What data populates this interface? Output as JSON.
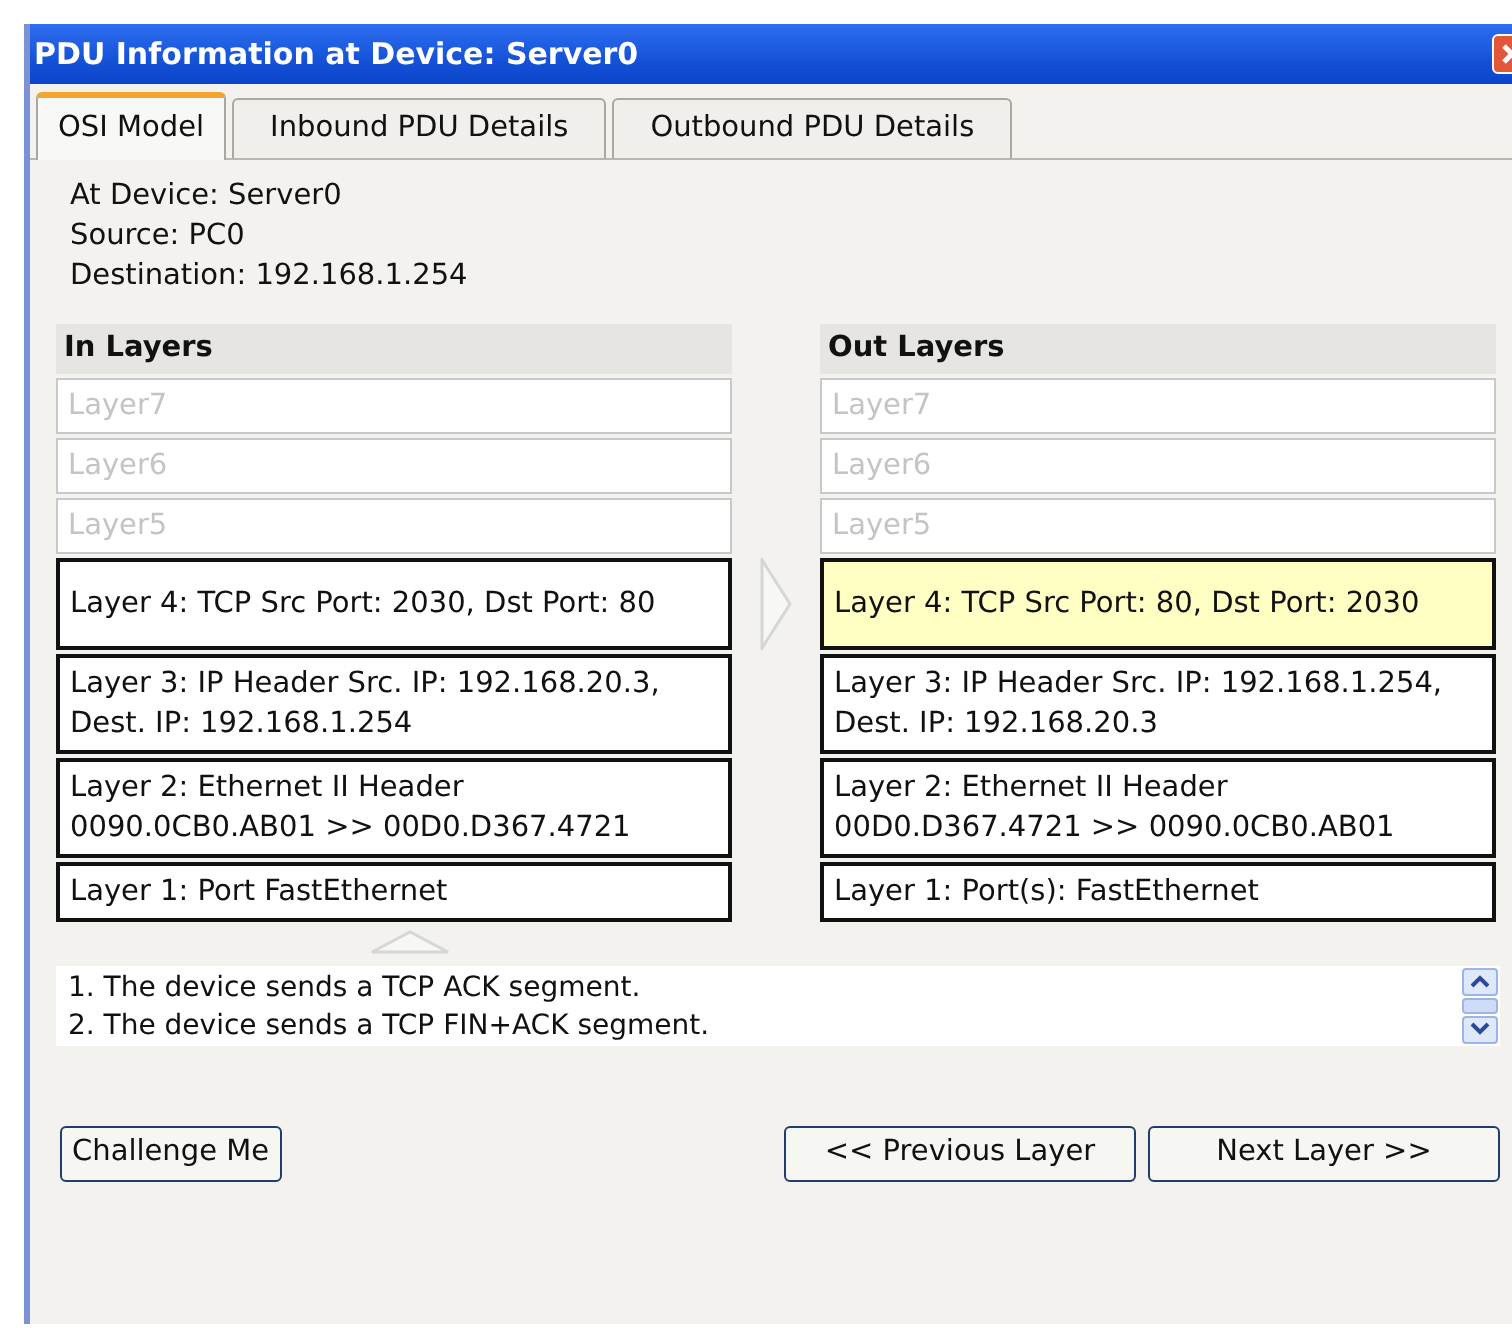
{
  "window": {
    "title": "PDU Information at Device: Server0"
  },
  "tabs": [
    {
      "label": "OSI Model",
      "selected": true
    },
    {
      "label": "Inbound PDU Details",
      "selected": false
    },
    {
      "label": "Outbound PDU Details",
      "selected": false
    }
  ],
  "info": [
    "At Device: Server0",
    "Source: PC0",
    "Destination: 192.168.1.254"
  ],
  "in_layers": {
    "heading": "In Layers",
    "layers": [
      {
        "text": "Layer7",
        "disabled": true,
        "selected": false
      },
      {
        "text": "Layer6",
        "disabled": true,
        "selected": false
      },
      {
        "text": "Layer5",
        "disabled": true,
        "selected": false
      },
      {
        "text": "Layer 4: TCP Src Port: 2030, Dst Port: 80",
        "disabled": false,
        "selected": false
      },
      {
        "text": "Layer 3: IP Header Src. IP: 192.168.20.3, Dest. IP: 192.168.1.254",
        "disabled": false,
        "selected": false
      },
      {
        "text": "Layer 2: Ethernet II Header 0090.0CB0.AB01 >> 00D0.D367.4721",
        "disabled": false,
        "selected": false
      },
      {
        "text": "Layer 1: Port FastEthernet",
        "disabled": false,
        "selected": false
      }
    ]
  },
  "out_layers": {
    "heading": "Out Layers",
    "layers": [
      {
        "text": "Layer7",
        "disabled": true,
        "selected": false
      },
      {
        "text": "Layer6",
        "disabled": true,
        "selected": false
      },
      {
        "text": "Layer5",
        "disabled": true,
        "selected": false
      },
      {
        "text": "Layer 4: TCP Src Port: 80, Dst Port: 2030",
        "disabled": false,
        "selected": true
      },
      {
        "text": "Layer 3: IP Header Src. IP: 192.168.1.254, Dest. IP: 192.168.20.3",
        "disabled": false,
        "selected": false
      },
      {
        "text": "Layer 2: Ethernet II Header 00D0.D367.4721 >> 0090.0CB0.AB01",
        "disabled": false,
        "selected": false
      },
      {
        "text": "Layer 1: Port(s): FastEthernet",
        "disabled": false,
        "selected": false
      }
    ]
  },
  "steps": [
    "1. The device sends a TCP ACK segment.",
    "2. The device sends a TCP FIN+ACK segment."
  ],
  "buttons_left": [
    "Challenge Me"
  ],
  "buttons_right": [
    "<< Previous Layer",
    "Next Layer >>"
  ]
}
